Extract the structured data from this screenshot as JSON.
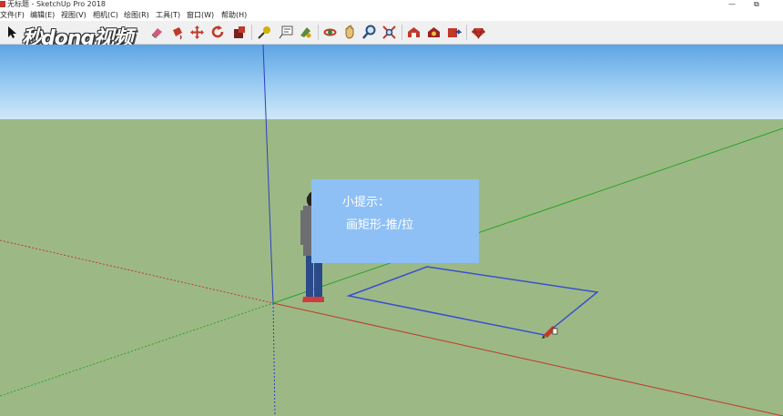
{
  "window": {
    "title": "无标题 - SketchUp Pro 2018",
    "minimize_glyph": "—",
    "restore_glyph": "⧉"
  },
  "menu": {
    "items": [
      "文件(F)",
      "编辑(E)",
      "视图(V)",
      "相机(C)",
      "绘图(R)",
      "工具(T)",
      "窗口(W)",
      "帮助(H)"
    ]
  },
  "toolbar": {
    "tools": [
      "select-tool",
      "make-component-tool",
      "eraser-tool",
      "paint-bucket-tool",
      "push-pull-tool",
      "move-tool",
      "rotate-tool",
      "scale-tool",
      "tape-measure-tool",
      "text-tool",
      "paint-tool",
      "orbit-tool",
      "pan-tool",
      "zoom-tool",
      "zoom-extents-tool",
      "warehouse-tool",
      "extension-warehouse-tool",
      "share-model-tool",
      "ruby-tool"
    ]
  },
  "watermark": {
    "text": "秒dong视频"
  },
  "tip": {
    "title": "小提示：",
    "text": "画矩形-推/拉"
  },
  "colors": {
    "sky_top": "#5da4e4",
    "ground": "#9cb985",
    "tip_box": "#8ec0f6",
    "red_axis": "#c0392b",
    "green_axis": "#27a327",
    "blue_axis": "#2c3fc4",
    "rectangle_edge": "#3a4fd0"
  }
}
